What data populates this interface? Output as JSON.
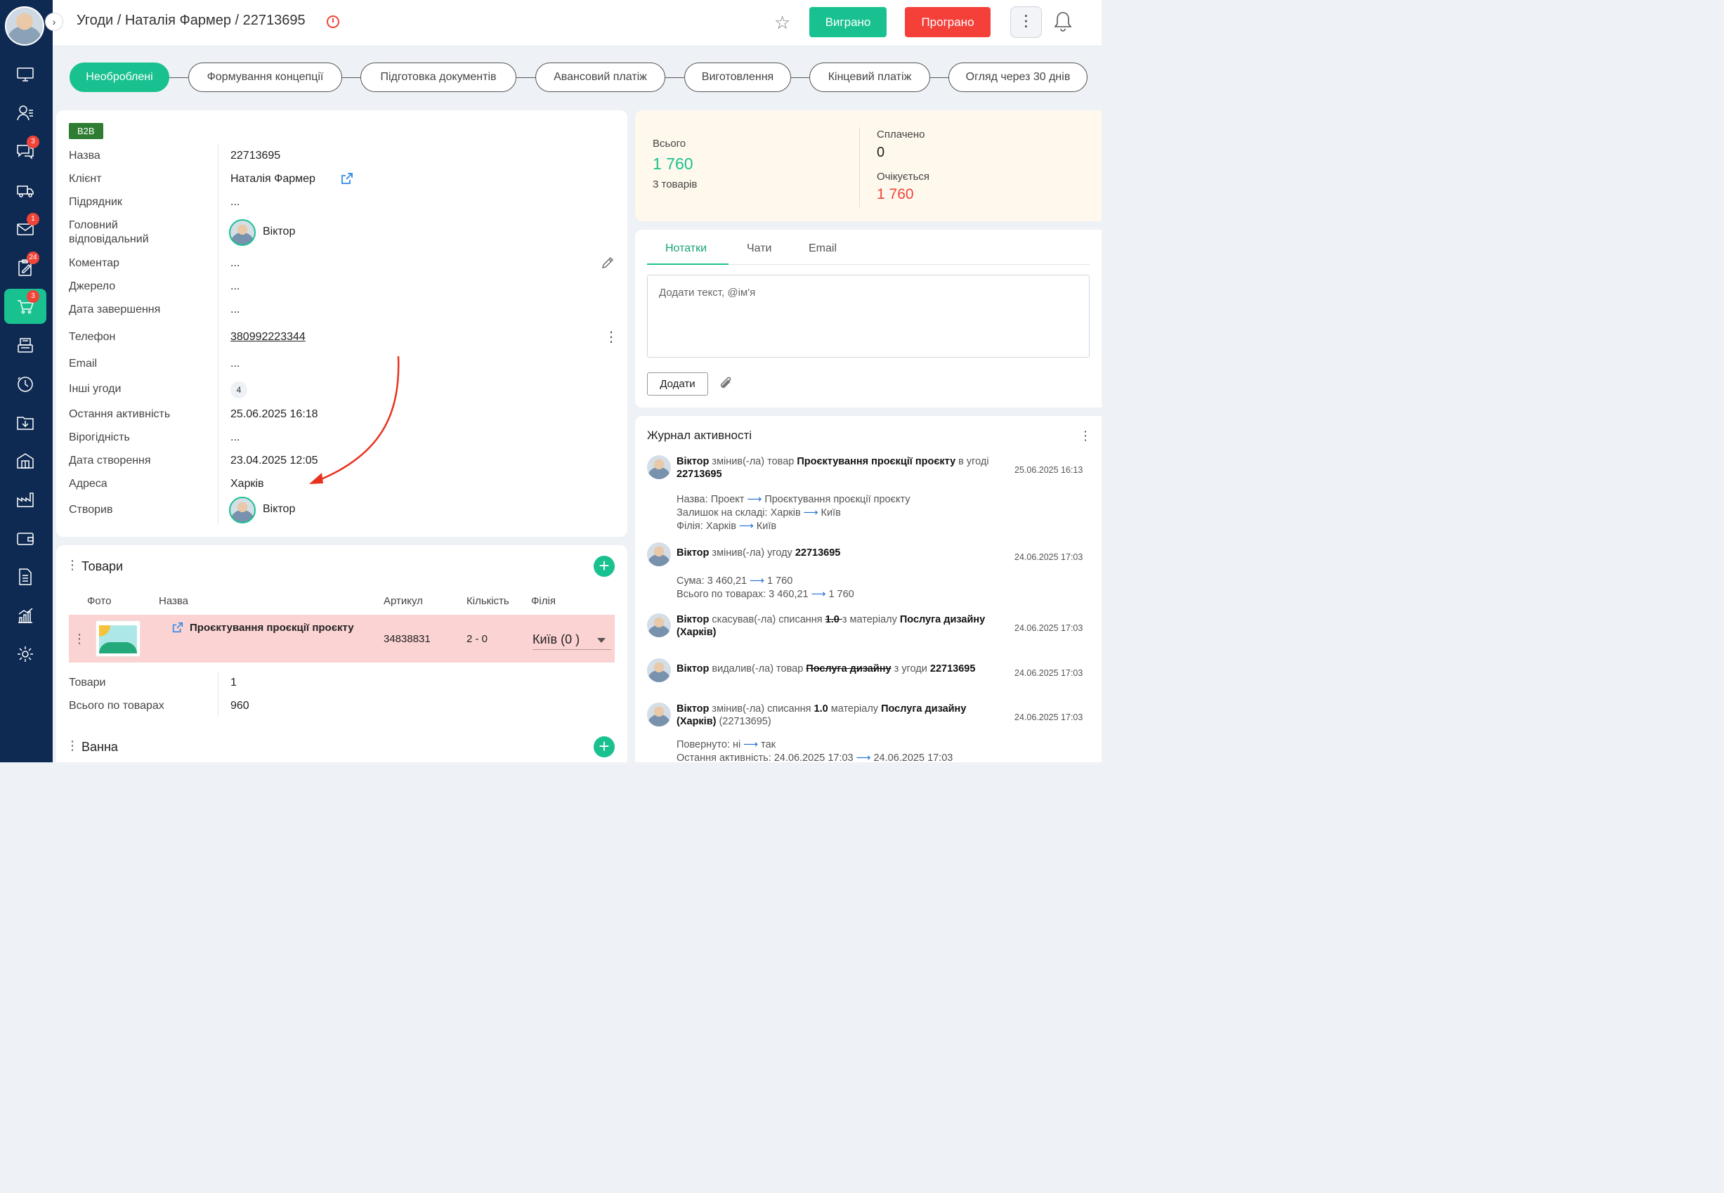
{
  "header": {
    "breadcrumb": "Угоди / Наталія Фармер / 22713695",
    "won_label": "Виграно",
    "lost_label": "Програно"
  },
  "sidebar": {
    "badges": {
      "chats": "3",
      "mail": "1",
      "tasks": "24",
      "deals": "3"
    }
  },
  "stages": [
    "Необроблені",
    "Формування концепції",
    "Підготовка документів",
    "Авансовий платіж",
    "Виготовлення",
    "Кінцевий платіж",
    "Огляд через 30 днів"
  ],
  "deal": {
    "tag": "B2B",
    "labels": {
      "name": "Назва",
      "client": "Клієнт",
      "contractor": "Підрядник",
      "manager_line1": "Головний",
      "manager_line2": "відповідальний",
      "comment": "Коментар",
      "source": "Джерело",
      "close_date": "Дата завершення",
      "phone": "Телефон",
      "email": "Email",
      "other_deals": "Інші угоди",
      "last_activity": "Остання активність",
      "probability": "Вірогідність",
      "created_date": "Дата створення",
      "address": "Адреса",
      "created_by": "Створив"
    },
    "values": {
      "name": "22713695",
      "client": "Наталія Фармер",
      "contractor": "...",
      "manager": "Віктор",
      "comment": "...",
      "source": "...",
      "close_date": "...",
      "phone": "380992223344",
      "email": "...",
      "other_deals": "4",
      "last_activity": "25.06.2025 16:18",
      "probability": "...",
      "created_date": "23.04.2025 12:05",
      "address": "Харків",
      "created_by": "Віктор"
    }
  },
  "goods": {
    "title": "Товари",
    "columns": {
      "photo": "Фото",
      "name": "Назва",
      "article": "Артикул",
      "qty": "Кількість",
      "branch": "Філія"
    },
    "row": {
      "name": "Проєктування проєкції проєкту",
      "article": "34838831",
      "qty": "2 - 0",
      "branch": "Київ (0 )"
    },
    "summary": {
      "items_label": "Товари",
      "items_value": "1",
      "total_label": "Всього по товарах",
      "total_value": "960"
    },
    "next_section": "Ванна"
  },
  "totals": {
    "total_label": "Всього",
    "total_value": "1 760",
    "items_count": "3 товарів",
    "paid_label": "Сплачено",
    "paid_value": "0",
    "expected_label": "Очікується",
    "expected_value": "1 760"
  },
  "notes": {
    "tabs": [
      "Нотатки",
      "Чати",
      "Email"
    ],
    "placeholder": "Додати текст, @ім'я",
    "add_label": "Додати"
  },
  "activity": {
    "title": "Журнал активності",
    "entries": [
      {
        "user": "Віктор",
        "action": " змінив(-ла) товар ",
        "object": "Проєктування проєкції проєкту",
        "suffix": " в угоді ",
        "target": "22713695",
        "time": "25.06.2025 16:13",
        "details": [
          {
            "label": "Назва:",
            "from": "Проект",
            "to": "Проєктування проєкції проєкту"
          },
          {
            "label": "Залишок на складі:",
            "from": "Харків",
            "to": "Київ"
          },
          {
            "label": "Філія:",
            "from": "Харків",
            "to": "Київ"
          }
        ]
      },
      {
        "user": "Віктор",
        "action": " змінив(-ла) угоду ",
        "target": "22713695",
        "time": "24.06.2025 17:03",
        "details": [
          {
            "label": "Сума:",
            "from": "3 460,21",
            "to": "1 760"
          },
          {
            "label": "Всього по товарах:",
            "from": "3 460,21",
            "to": "1 760"
          }
        ]
      },
      {
        "user": "Віктор",
        "action": " скасував(-ла) списання ",
        "struck": "1.0 ",
        "suffix": "з матеріалу ",
        "object": "Послуга дизайну (Харків)",
        "time": "24.06.2025 17:03"
      },
      {
        "user": "Віктор",
        "action": " видалив(-ла) товар ",
        "struck": "Послуга дизайну",
        "suffix": " з угоди ",
        "target": "22713695",
        "time": "24.06.2025 17:03"
      },
      {
        "user": "Віктор",
        "action": " змінив(-ла) списання ",
        "amount": "1.0",
        "suffix": " матеріалу ",
        "object": "Послуга дизайну (Харків)",
        "tail": " (22713695)",
        "time": "24.06.2025 17:03",
        "details": [
          {
            "label": "Повернуто:",
            "from": "ні",
            "to": "так"
          },
          {
            "label": "Остання активність:",
            "from": "24.06.2025 17:03",
            "to": "24.06.2025 17:03"
          }
        ]
      }
    ]
  }
}
